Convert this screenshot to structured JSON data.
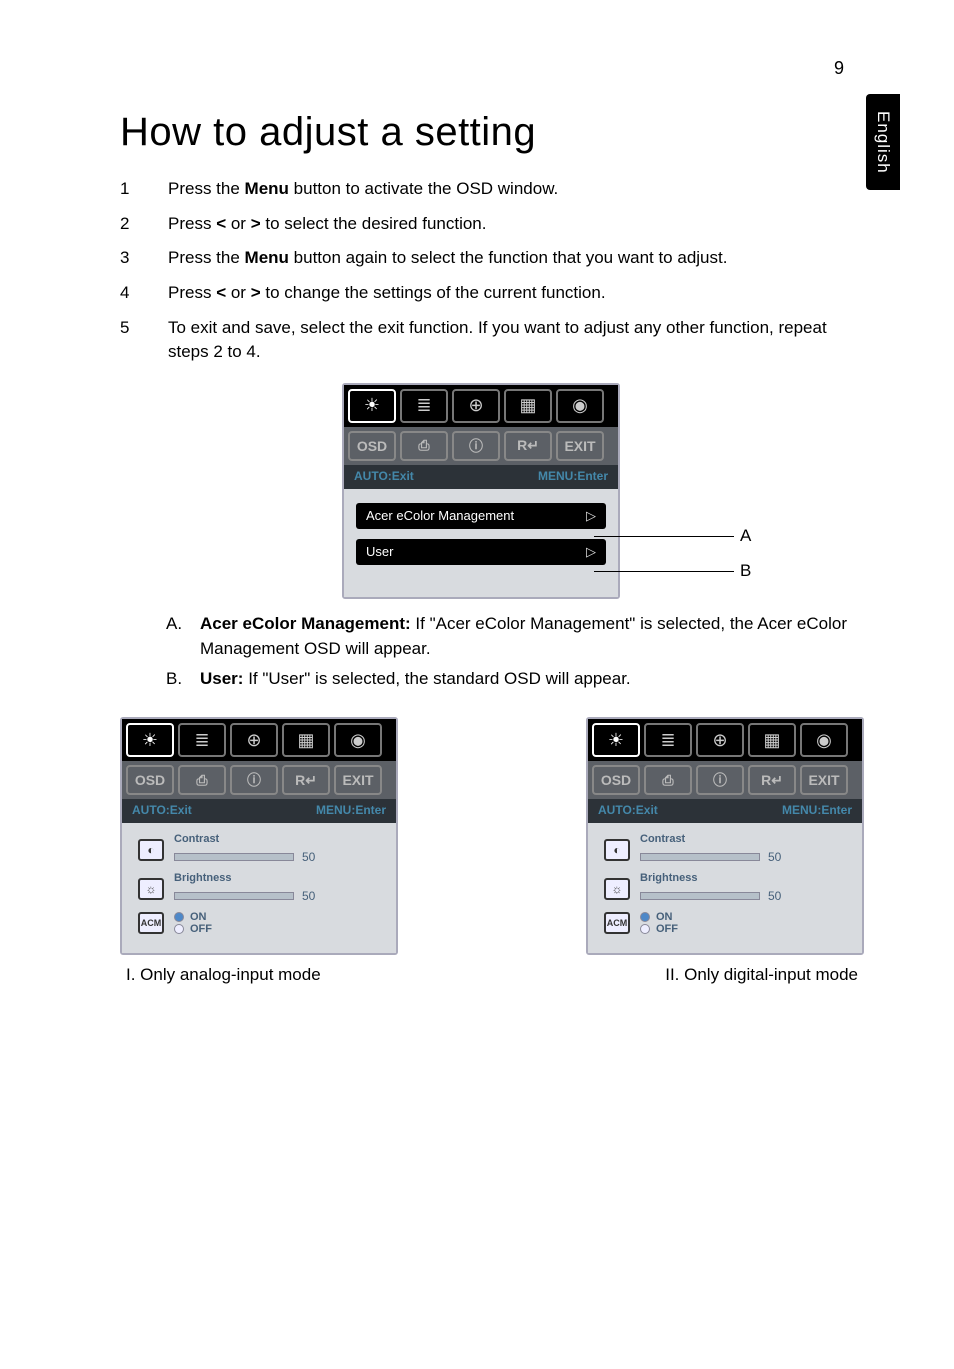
{
  "page_number": "9",
  "side_tab": "English",
  "title": "How to adjust a setting",
  "steps": [
    {
      "pre": "Press the ",
      "bold": "Menu",
      "post": " button to activate the OSD window."
    },
    {
      "pre": "Press ",
      "bold": "<",
      "mid": " or ",
      "bold2": ">",
      "post": " to select the desired function."
    },
    {
      "pre": "Press the ",
      "bold": "Menu",
      "post": " button again to select the function that you want to adjust."
    },
    {
      "pre": "Press ",
      "bold": "<",
      "mid": " or ",
      "bold2": ">",
      "post": " to change the settings of the current function."
    },
    {
      "pre": "To exit and save, select the exit function. If you want to adjust any other function, repeat steps 2 to 4.",
      "bold": "",
      "post": ""
    }
  ],
  "osd": {
    "hint_left": "AUTO:Exit",
    "hint_right": "MENU:Enter",
    "row_a": "Acer eColor Management",
    "row_b": "User",
    "label_a": "A",
    "label_b": "B",
    "sub_labels": [
      "OSD",
      "⎙",
      "ⓘ",
      "R↵",
      "EXIT"
    ]
  },
  "sublist": {
    "a_letter": "A.",
    "a_bold": "Acer eColor Management:",
    "a_text": " If \"Acer eColor Management\" is selected, the Acer eColor Management OSD will appear.",
    "b_letter": "B.",
    "b_bold": "User:",
    "b_text": " If \"User\" is selected, the standard OSD will appear."
  },
  "settings": {
    "contrast_label": "Contrast",
    "contrast_val": "50",
    "brightness_label": "Brightness",
    "brightness_val": "50",
    "acm": "ACM",
    "on": "ON",
    "off": "OFF"
  },
  "captions": {
    "left": "I. Only analog-input mode",
    "right": "II. Only digital-input mode"
  },
  "icons": {
    "sun": "☀",
    "list": "≣",
    "pos": "⊕",
    "color": "▦",
    "globe": "◉",
    "contrast": "◐",
    "bright": "☼"
  }
}
